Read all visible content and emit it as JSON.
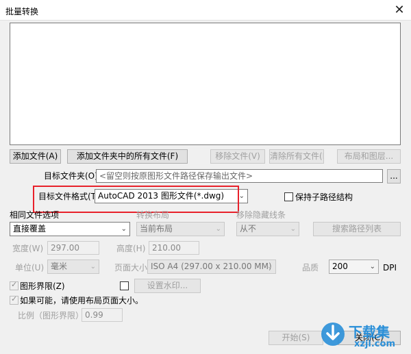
{
  "window": {
    "title": "批量转换",
    "close_glyph": "✕"
  },
  "buttons": {
    "add_file": "添加文件(A)",
    "add_folder_all": "添加文件夹中的所有文件(F)",
    "remove_file": "移除文件(V)",
    "clear_all": "清除所有文件(L)",
    "layouts": "布局和图层...",
    "browse": "...",
    "search_paths": "搜索路径列表",
    "watermark": "设置水印...",
    "start": "开始(S)",
    "close": "关闭(C)"
  },
  "target_folder": {
    "label": "目标文件夹(O)",
    "placeholder": "<留空则按原图形文件路径保存输出文件>"
  },
  "target_format": {
    "label": "目标文件格式(T)",
    "value": "AutoCAD 2013 图形文件(*.dwg)"
  },
  "keep_subpath": {
    "label": "保持子路径结构"
  },
  "same_file_option": {
    "label": "相同文件选项",
    "value": "直接覆盖"
  },
  "convert_layout": {
    "label": "转换布局",
    "value": "当前布局"
  },
  "remove_hidden": {
    "label": "移除隐藏线条",
    "value": "从不"
  },
  "width": {
    "label": "宽度(W)",
    "value": "297.00"
  },
  "height": {
    "label": "高度(H)",
    "value": "210.00"
  },
  "unit": {
    "label": "单位(U)",
    "value": "毫米"
  },
  "page_size": {
    "label": "页面大小",
    "value": "ISO A4 (297.00 x 210.00 MM)"
  },
  "quality": {
    "label": "品质",
    "value": "200",
    "unit": "DPI"
  },
  "drawing_limits": {
    "label": "图形界限(Z)",
    "checked": true
  },
  "use_layout_size": {
    "label": "如果可能，请使用布局页面大小。",
    "checked": true
  },
  "scale": {
    "label": "比例（图形界限）",
    "value": "0.99"
  },
  "watermark_brand": {
    "name": "下载集",
    "url": "xzji.com"
  },
  "colors": {
    "highlight": "#e8202a",
    "brand_blue": "#2a8fd8"
  }
}
